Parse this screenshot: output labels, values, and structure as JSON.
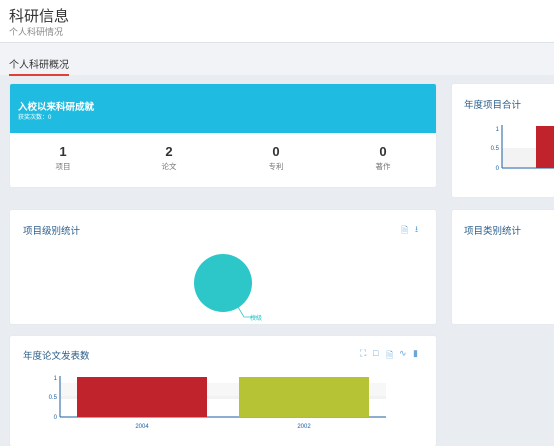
{
  "header": {
    "title": "科研信息",
    "subtitle": "个人科研情况"
  },
  "tab": {
    "label": "个人科研概况"
  },
  "summary": {
    "title": "入校以来科研成就",
    "subtitle": "获奖次数：0",
    "stats": [
      {
        "value": "1",
        "label": "项目"
      },
      {
        "value": "2",
        "label": "论文"
      },
      {
        "value": "0",
        "label": "专利"
      },
      {
        "value": "0",
        "label": "著作"
      }
    ]
  },
  "yearly_projects": {
    "title": "年度项目合计",
    "chart_data": {
      "type": "bar",
      "title": "",
      "yticks": [
        "1",
        "0.5",
        "0"
      ],
      "ylim": [
        0,
        1
      ],
      "series": [
        {
          "values": [
            1
          ],
          "color": "#c0232b"
        }
      ]
    }
  },
  "project_level": {
    "title": "项目级别统计",
    "tools": [
      "file-icon",
      "download-icon"
    ],
    "chart_data": {
      "type": "pie",
      "labels": [
        "校级"
      ],
      "values": [
        1
      ],
      "colors": [
        "#2ec7c9"
      ]
    }
  },
  "project_category": {
    "title": "项目类别统计"
  },
  "yearly_papers": {
    "title": "年度论文发表数",
    "tools": [
      "zoom-icon",
      "reset-icon",
      "data-view-icon",
      "line-icon",
      "bar-icon"
    ],
    "chart_data": {
      "type": "bar",
      "categories": [
        "2004",
        "2002"
      ],
      "values": [
        1,
        1
      ],
      "colors": [
        "#c0232b",
        "#b5c334"
      ],
      "yticks": [
        "1",
        "0.5",
        "0"
      ],
      "ylim": [
        0,
        1
      ]
    }
  }
}
